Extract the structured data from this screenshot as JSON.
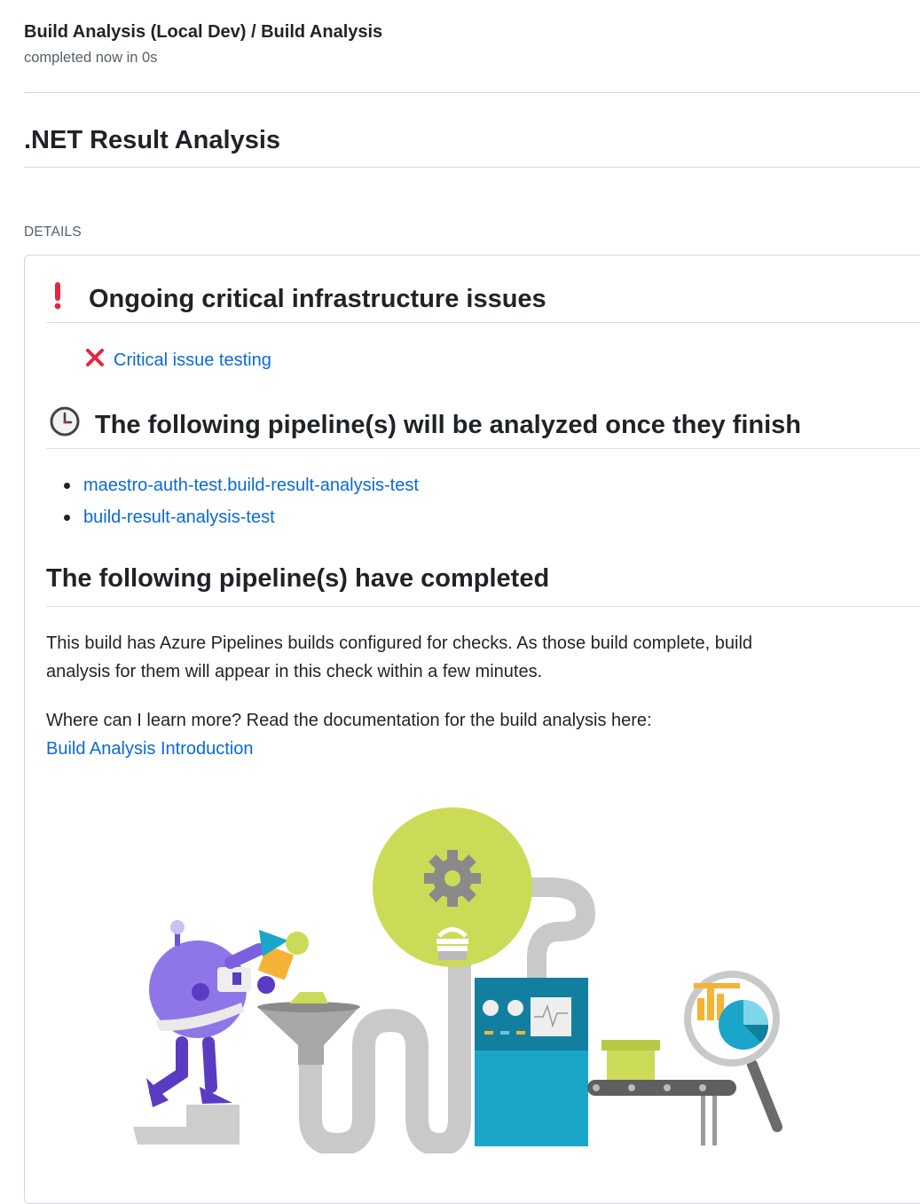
{
  "header": {
    "title": "Build Analysis (Local Dev) / Build Analysis",
    "subtitle": "completed now in 0s"
  },
  "main_title": ".NET Result Analysis",
  "details_label": "DETAILS",
  "critical": {
    "heading": "Ongoing critical infrastructure issues",
    "icon": "exclamation-icon",
    "items": [
      {
        "label": "Critical issue testing",
        "icon": "cross-icon"
      }
    ]
  },
  "pending": {
    "heading": "The following pipeline(s) will be analyzed once they finish",
    "icon": "clock-icon",
    "pipelines": [
      "maestro-auth-test.build-result-analysis-test",
      "build-result-analysis-test"
    ]
  },
  "completed": {
    "heading": "The following pipeline(s) have completed",
    "para1": "This build has Azure Pipelines builds configured for checks. As those build complete, build analysis for them will appear in this check within a few minutes.",
    "para2": "Where can I learn more? Read the documentation for the build analysis here:",
    "doc_link": "Build Analysis Introduction"
  },
  "colors": {
    "link": "#0969da",
    "critical_red": "#e5263f",
    "robot_purple": "#7b5fe0",
    "bulb_green": "#cbdb58",
    "machine_teal": "#1ba6c9"
  }
}
